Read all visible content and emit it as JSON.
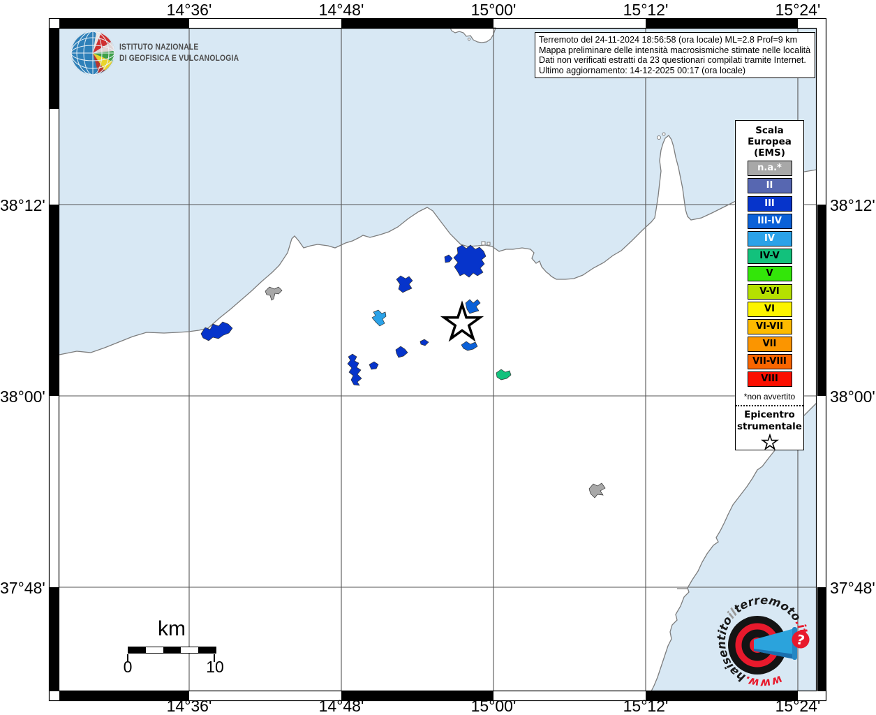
{
  "info_box": {
    "lines": [
      "Terremoto del 24-11-2024 18:56:58 (ora locale) ML=2.8 Prof=9 km",
      "Mappa preliminare delle intensità macrosismiche stimate nelle località",
      "Dati non verificati estratti da 23 questionari compilati tramite Internet.",
      "Ultimo aggiornamento: 14-12-2025 00:17 (ora locale)"
    ]
  },
  "branding": {
    "institute_line1": "ISTITUTO NAZIONALE",
    "institute_line2": "DI GEOFISICA E VULCANOLOGIA"
  },
  "axes": {
    "top": [
      "14°36'",
      "14°48'",
      "15°00'",
      "15°12'",
      "15°24'"
    ],
    "bottom": [
      "14°36'",
      "14°48'",
      "15°00'",
      "15°12'",
      "15°24'"
    ],
    "left": [
      "38°12'",
      "38°00'",
      "37°48'"
    ],
    "right": [
      "38°12'",
      "38°00'",
      "37°48'"
    ]
  },
  "legend": {
    "title_lines": [
      "Scala",
      "Europea",
      "(EMS)"
    ],
    "items": [
      {
        "label": "n.a.*",
        "color": "#a8a8a8",
        "text_color": "#ffffff"
      },
      {
        "label": "II",
        "color": "#5767b1",
        "text_color": "#ffffff"
      },
      {
        "label": "III",
        "color": "#0634cb",
        "text_color": "#ffffff"
      },
      {
        "label": "III-IV",
        "color": "#0b61d8",
        "text_color": "#ffffff"
      },
      {
        "label": "IV",
        "color": "#2ba2e8",
        "text_color": "#ffffff"
      },
      {
        "label": "IV-V",
        "color": "#12c17c",
        "text_color": "#000000"
      },
      {
        "label": "V",
        "color": "#33e609",
        "text_color": "#000000"
      },
      {
        "label": "V-VI",
        "color": "#b5e000",
        "text_color": "#000000"
      },
      {
        "label": "VI",
        "color": "#fdf400",
        "text_color": "#000000"
      },
      {
        "label": "VI-VII",
        "color": "#fdba00",
        "text_color": "#000000"
      },
      {
        "label": "VII",
        "color": "#fb9500",
        "text_color": "#000000"
      },
      {
        "label": "VII-VIII",
        "color": "#f96500",
        "text_color": "#000000"
      },
      {
        "label": "VIII",
        "color": "#fb0f00",
        "text_color": "#000000"
      }
    ],
    "footnote": "*non avvertito",
    "epicenter_label_line1": "Epicentro",
    "epicenter_label_line2": "strumentale"
  },
  "scale_bar": {
    "unit": "km",
    "start": "0",
    "end": "10"
  },
  "map": {
    "sea_color": "#d8e8f4",
    "land_color": "#ffffff",
    "grid_color": "#555555",
    "coast_color": "#7d7d7d",
    "palette": {
      "na": "#a8a8a8",
      "II": "#5767b1",
      "III": "#0634cb",
      "III-IV": "#0b61d8",
      "IV": "#2ba2e8",
      "IV-V": "#12c17c",
      "V": "#33e609",
      "V-VI": "#b5e000",
      "VI": "#fdf400",
      "VI-VII": "#fdba00",
      "VII": "#fb9500",
      "VII-VIII": "#f96500",
      "VIII": "#fb0f00"
    },
    "towns": [
      {
        "intensity": "III"
      },
      {
        "intensity": "na"
      },
      {
        "intensity": "III"
      },
      {
        "intensity": "IV"
      },
      {
        "intensity": "III"
      },
      {
        "intensity": "III"
      },
      {
        "intensity": "III-IV"
      },
      {
        "intensity": "III-IV"
      },
      {
        "intensity": "III"
      },
      {
        "intensity": "III"
      },
      {
        "intensity": "III"
      },
      {
        "intensity": "III"
      },
      {
        "intensity": "IV-V"
      },
      {
        "intensity": "na"
      }
    ]
  },
  "watermark": {
    "url_parts": [
      {
        "text": "www.",
        "color": "#e8192c"
      },
      {
        "text": "haisentito",
        "color": "#1a1a1a"
      },
      {
        "text": "il",
        "color": "#9a9a9a"
      },
      {
        "text": "terremoto",
        "color": "#1a1a1a"
      },
      {
        "text": ".it",
        "color": "#e8192c"
      }
    ],
    "question_mark": "?"
  }
}
